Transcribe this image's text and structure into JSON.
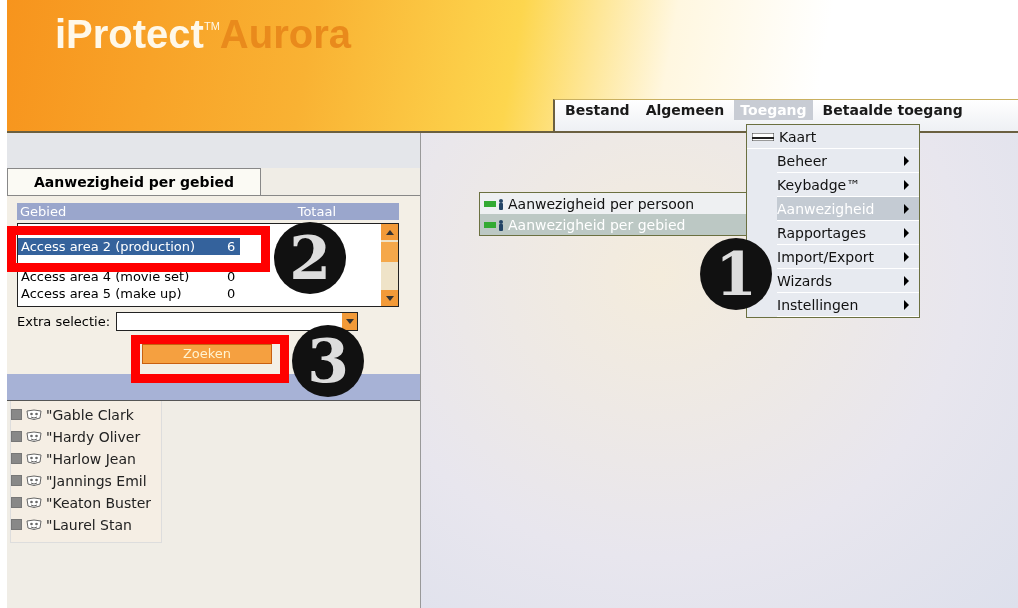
{
  "logo": {
    "name": "iProtect",
    "trademark": "TM",
    "product": "Aurora"
  },
  "menu_bar": [
    {
      "label": "Bestand",
      "selected": false
    },
    {
      "label": "Algemeen",
      "selected": false
    },
    {
      "label": "Toegang",
      "selected": true
    },
    {
      "label": "Betaalde toegang",
      "selected": false
    }
  ],
  "dropdown": [
    {
      "label": "Kaart",
      "kind": "card",
      "selected": false
    },
    {
      "label": "Beheer",
      "kind": "submenu",
      "selected": false
    },
    {
      "label": "Keybadge™",
      "kind": "submenu",
      "selected": false
    },
    {
      "label": "Aanwezigheid",
      "kind": "submenu",
      "selected": true
    },
    {
      "label": "Rapportages",
      "kind": "submenu",
      "selected": false
    },
    {
      "label": "Import/Export",
      "kind": "submenu",
      "selected": false
    },
    {
      "label": "Wizards",
      "kind": "submenu",
      "selected": false
    },
    {
      "label": "Instellingen",
      "kind": "submenu",
      "selected": false
    }
  ],
  "submenu": [
    {
      "label": "Aanwezigheid per persoon",
      "selected": false
    },
    {
      "label": "Aanwezigheid per gebied",
      "selected": true
    }
  ],
  "panel": {
    "tab": "Aanwezigheid per gebied",
    "columns": [
      "Gebied",
      "Totaal"
    ],
    "rows": [
      {
        "area": "Access area 2 (production)",
        "count": "6",
        "selected": true
      },
      {
        "area": "Access area 4 (movie set)",
        "count": "0",
        "selected": false
      },
      {
        "area": "Access area 5 (make up)",
        "count": "0",
        "selected": false
      }
    ],
    "extra_label": "Extra selectie:",
    "search_button": "Zoeken"
  },
  "tree": [
    {
      "label": "\"Gable Clark"
    },
    {
      "label": "\"Hardy Oliver"
    },
    {
      "label": "\"Harlow Jean"
    },
    {
      "label": "\"Jannings Emil"
    },
    {
      "label": "\"Keaton Buster"
    },
    {
      "label": "\"Laurel Stan"
    }
  ],
  "callouts": [
    {
      "number": "1"
    },
    {
      "number": "2"
    },
    {
      "number": "3"
    }
  ]
}
